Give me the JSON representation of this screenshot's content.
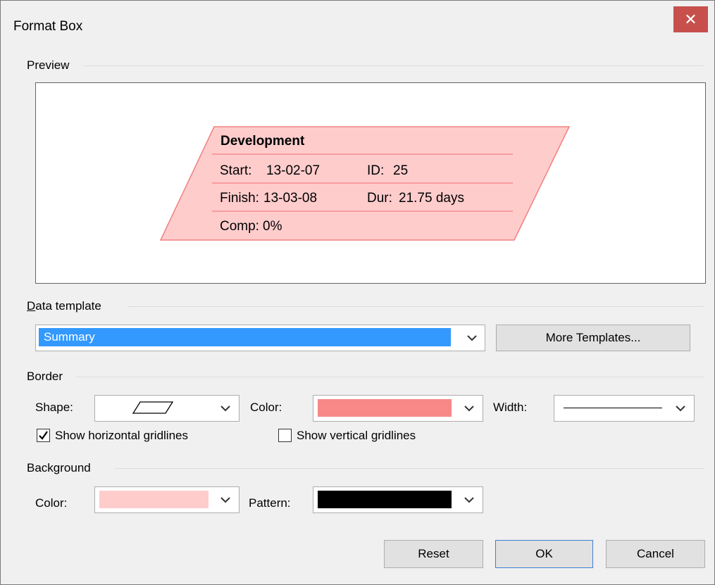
{
  "dialog": {
    "title": "Format Box",
    "close_glyph": "✕"
  },
  "preview": {
    "label": "Preview",
    "node": {
      "title": "Development",
      "start_label": "Start:",
      "start_value": "13-02-07",
      "id_label": "ID:",
      "id_value": "25",
      "finish_label": "Finish:",
      "finish_value": "13-03-08",
      "dur_label": "Dur:",
      "dur_value": "21.75 days",
      "comp_label": "Comp:",
      "comp_value": "0%",
      "fill_color": "#ffcccc",
      "border_color": "#f08080"
    }
  },
  "data_template": {
    "label_first": "D",
    "label_rest": "ata template",
    "selected": "Summary",
    "more_button": "More Templates..."
  },
  "border": {
    "label": "Border",
    "shape_label": "Shape:",
    "color_label": "Color:",
    "color_value": "#f88888",
    "width_label": "Width:",
    "show_horizontal": "Show horizontal gridlines",
    "show_horizontal_checked": true,
    "show_vertical": "Show vertical gridlines",
    "show_vertical_checked": false
  },
  "background": {
    "label": "Background",
    "color_label": "Color:",
    "color_value": "#ffcccc",
    "pattern_label": "Pattern:",
    "pattern_value": "#000000"
  },
  "buttons": {
    "reset": "Reset",
    "ok": "OK",
    "cancel": "Cancel"
  }
}
